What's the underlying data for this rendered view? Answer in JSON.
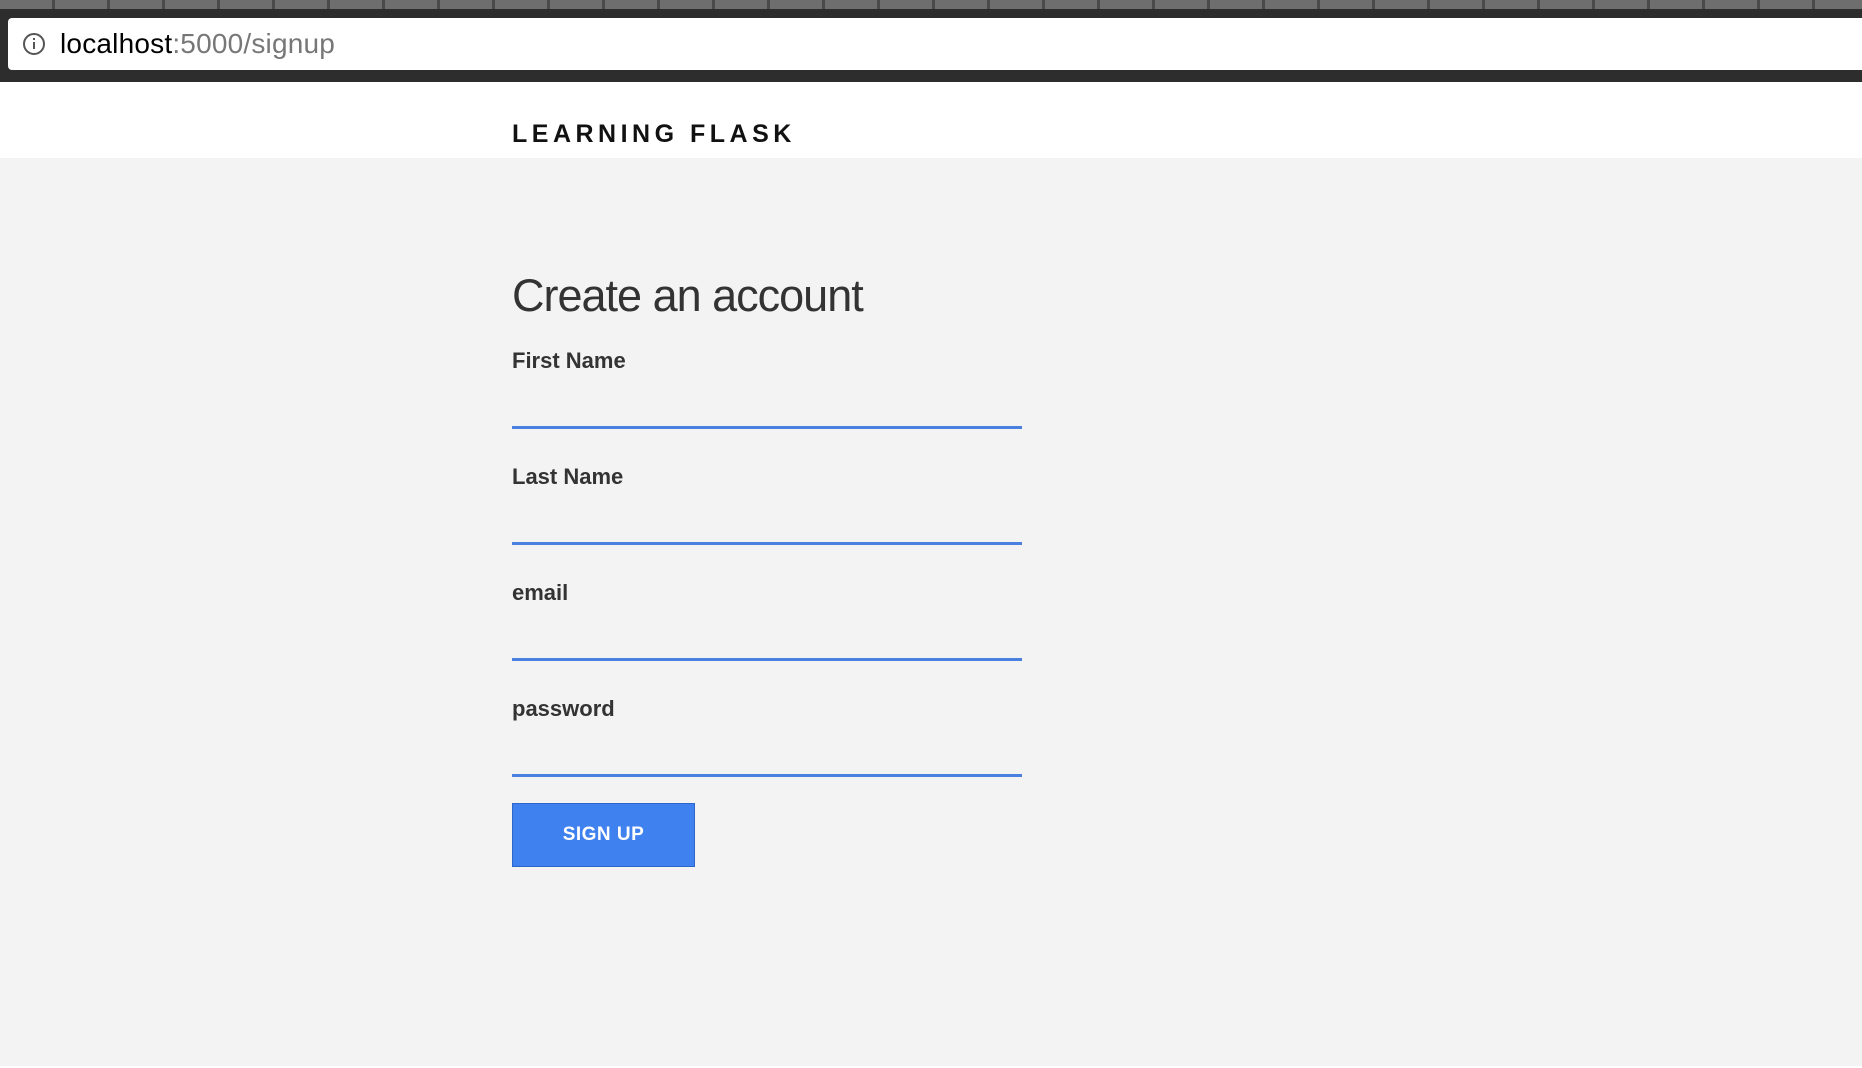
{
  "browser": {
    "url_host": "localhost",
    "url_path": ":5000/signup",
    "info_icon": "info-circle-icon"
  },
  "header": {
    "brand": "LEARNING FLASK"
  },
  "form": {
    "title": "Create an account",
    "fields": [
      {
        "label": "First Name",
        "value": ""
      },
      {
        "label": "Last Name",
        "value": ""
      },
      {
        "label": "email",
        "value": ""
      },
      {
        "label": "password",
        "value": ""
      }
    ],
    "submit_label": "SIGN UP"
  },
  "colors": {
    "accent": "#3f81ee",
    "underline": "#4a80df",
    "page_background": "#f3f3f3",
    "header_background": "#ffffff",
    "browser_chrome": "#2d2d2d"
  }
}
